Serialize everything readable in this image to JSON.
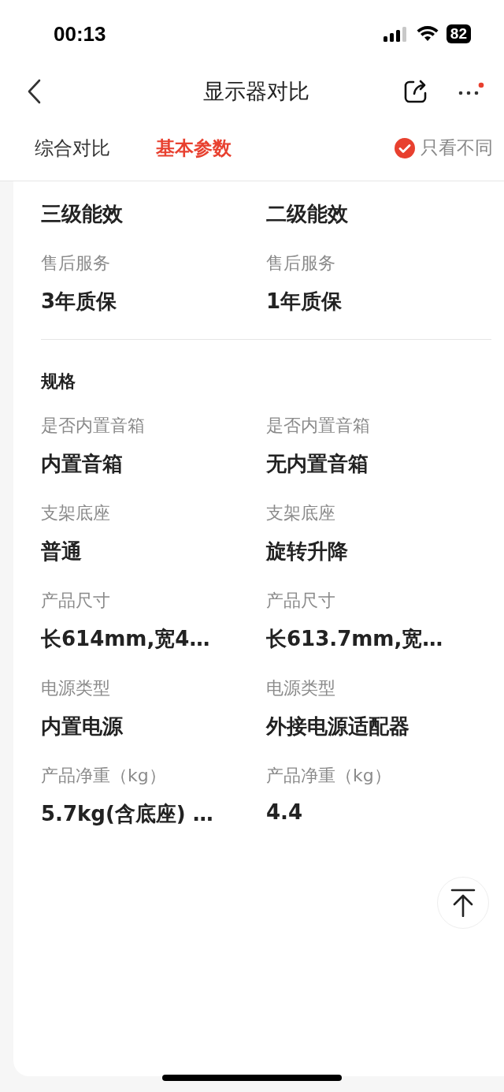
{
  "status_bar": {
    "time": "00:13",
    "battery": "82"
  },
  "nav": {
    "title": "显示器对比",
    "more_badge": true
  },
  "tabs": [
    {
      "label": "综合对比",
      "selected": false
    },
    {
      "label": "基本参数",
      "selected": true
    }
  ],
  "diff_filter": {
    "label": "只看不同",
    "checked": true
  },
  "sections": [
    {
      "items": [
        {
          "cells": [
            {
              "value": "三级能效"
            },
            {
              "value": "二级能效"
            }
          ]
        },
        {
          "cells": [
            {
              "label": "售后服务",
              "value": "3年质保"
            },
            {
              "label": "售后服务",
              "value": "1年质保"
            }
          ]
        }
      ]
    },
    {
      "title": "规格",
      "items": [
        {
          "cells": [
            {
              "label": "是否内置音箱",
              "value": "内置音箱"
            },
            {
              "label": "是否内置音箱",
              "value": "无内置音箱"
            }
          ]
        },
        {
          "cells": [
            {
              "label": "支架底座",
              "value": "普通"
            },
            {
              "label": "支架底座",
              "value": "旋转升降"
            }
          ]
        },
        {
          "cells": [
            {
              "label": "产品尺寸",
              "value": "长614mm,宽4…"
            },
            {
              "label": "产品尺寸",
              "value": "长613.7mm,宽…"
            }
          ]
        },
        {
          "cells": [
            {
              "label": "电源类型",
              "value": "内置电源"
            },
            {
              "label": "电源类型",
              "value": "外接电源适配器"
            }
          ]
        },
        {
          "cells": [
            {
              "label": "产品净重（kg）",
              "value": "5.7kg(含底座) …"
            },
            {
              "label": "产品净重（kg）",
              "value": "4.4"
            }
          ]
        }
      ]
    }
  ]
}
